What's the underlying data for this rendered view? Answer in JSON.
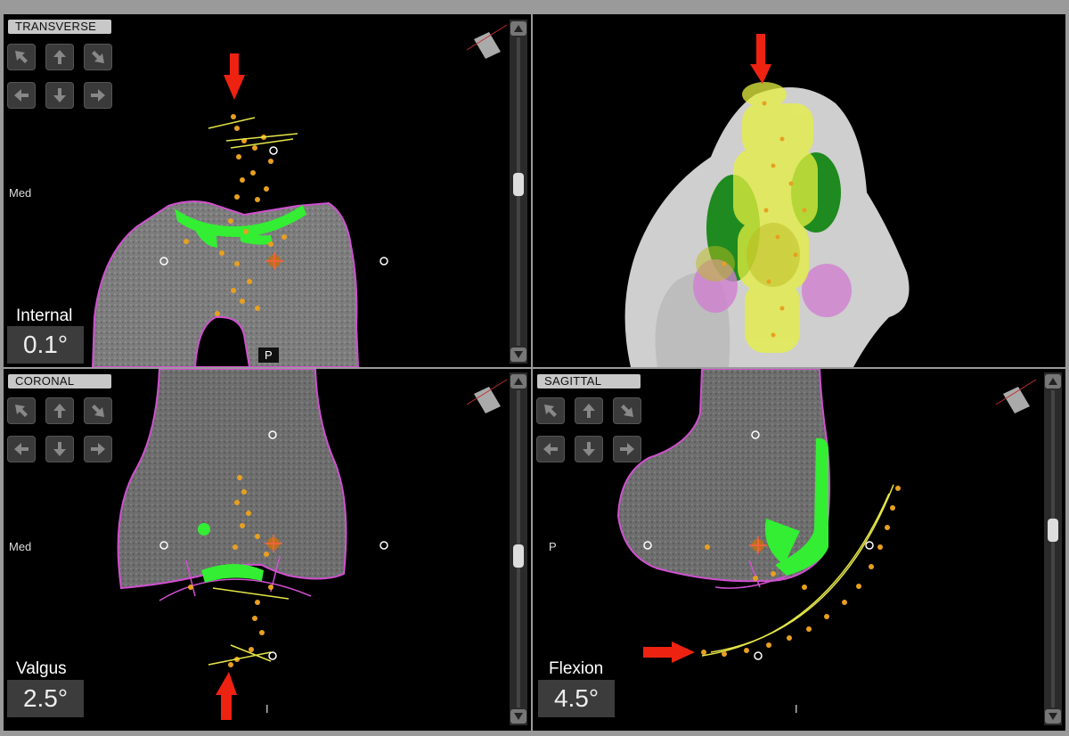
{
  "views": {
    "transverse": {
      "title": "TRANSVERSE",
      "side_label": "Med",
      "angle_label": "Internal",
      "angle_value": "0.1°",
      "bottom_label": "P"
    },
    "coronal": {
      "title": "CORONAL",
      "side_label": "Med",
      "angle_label": "Valgus",
      "angle_value": "2.5°",
      "bottom_label": "I"
    },
    "sagittal": {
      "title": "SAGITTAL",
      "side_label": "P",
      "angle_label": "Flexion",
      "angle_value": "4.5°",
      "bottom_label": "I"
    }
  },
  "icons": {
    "nav": [
      "arrow-up-left-icon",
      "arrow-up-icon",
      "arrow-up-right-icon",
      "arrow-left-icon",
      "arrow-down-icon",
      "arrow-right-icon"
    ],
    "orientation": "plane-orientation-icon",
    "annotation": "red-arrow-icon"
  },
  "colors": {
    "bone_outline": "#d050d0",
    "marker": "#e8a020",
    "implant_green": "#33ee33",
    "annotation_red": "#ee2211",
    "bone_3d": "#cfcfcf"
  }
}
